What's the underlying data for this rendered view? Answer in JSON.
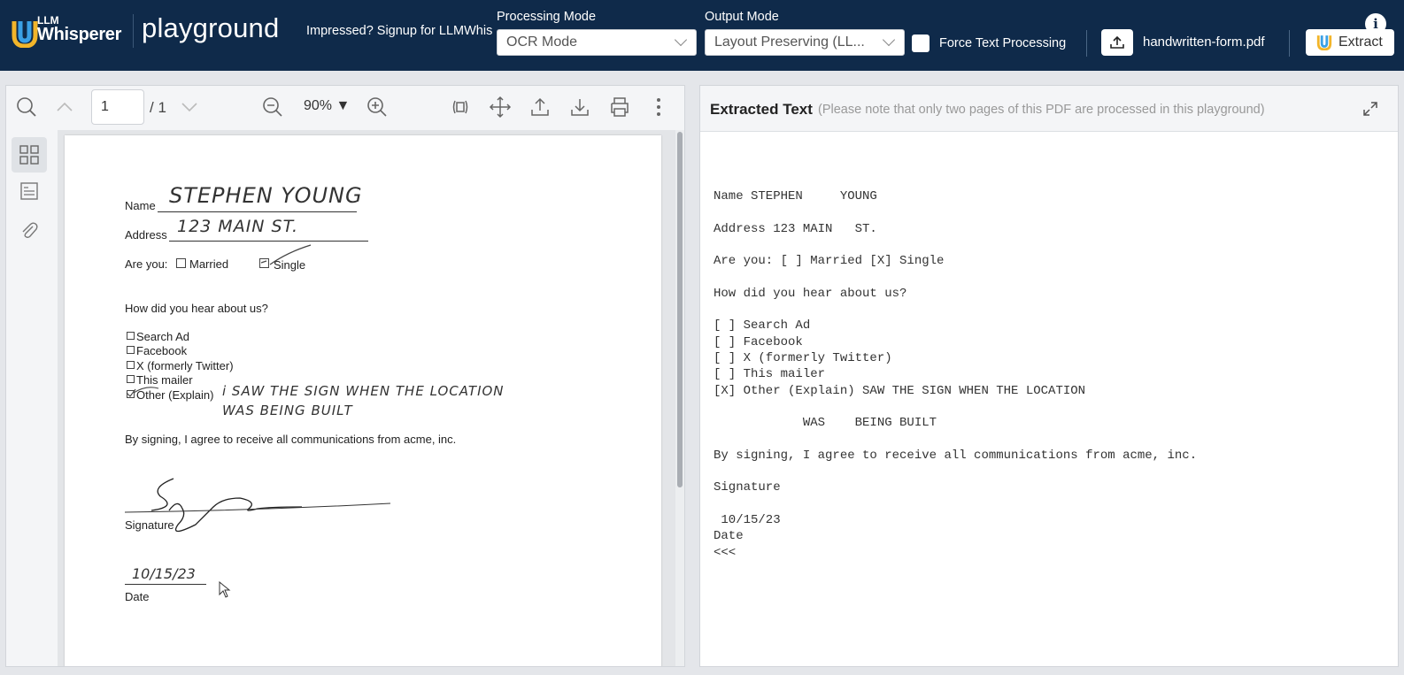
{
  "header": {
    "logo_top": "LLM",
    "logo_bottom": "Whisperer",
    "app_name": "playground",
    "promo": "Impressed? Signup for LLMWhisperer",
    "processing_mode_label": "Processing Mode",
    "processing_mode_value": "OCR Mode",
    "output_mode_label": "Output Mode",
    "output_mode_value": "Layout Preserving (LL...",
    "force_text_label": "Force Text Processing",
    "filename": "handwritten-form.pdf",
    "extract_label": "Extract",
    "info_glyph": "i",
    "brand_colors": {
      "navy": "#0f2a4a",
      "logo_blue": "#3aa0e6",
      "logo_yellow": "#f2b52a"
    }
  },
  "viewer": {
    "page_current": "1",
    "page_total": "/ 1",
    "zoom": "90% ▼",
    "icons": [
      "search-icon",
      "page-up-icon",
      "page-down-icon",
      "zoom-out-icon",
      "zoom-in-icon",
      "rotate-icon",
      "pan-icon",
      "upload-icon",
      "download-icon",
      "print-icon",
      "more-icon"
    ],
    "rail_icons": [
      "thumbnails-icon",
      "outline-icon",
      "attachment-icon"
    ]
  },
  "form": {
    "name_label": "Name",
    "name_value": "STEPHEN YOUNG",
    "address_label": "Address",
    "address_value": "123 MAIN ST.",
    "are_you_label": "Are you:",
    "married_label": "Married",
    "single_label": "Single",
    "question": "How did you hear about us?",
    "options": [
      "Search Ad",
      "Facebook",
      "X (formerly Twitter)",
      "This mailer",
      "Other (Explain)"
    ],
    "other_line1": "i SAW THE SIGN WHEN THE LOCATION",
    "other_line2": "WAS BEING BUILT",
    "consent": "By signing, I agree to receive all communications from acme, inc.",
    "signature_label": "Signature",
    "date_value": "10/15/23",
    "date_label": "Date"
  },
  "output": {
    "title": "Extracted Text",
    "note": "(Please note that only two pages of this PDF are processed in this playground)",
    "text": "Name STEPHEN     YOUNG\n\nAddress 123 MAIN   ST.\n\nAre you: [ ] Married [X] Single\n\nHow did you hear about us?\n\n[ ] Search Ad\n[ ] Facebook\n[ ] X (formerly Twitter)\n[ ] This mailer\n[X] Other (Explain) SAW THE SIGN WHEN THE LOCATION\n\n            WAS    BEING BUILT\n\nBy signing, I agree to receive all communications from acme, inc.\n\nSignature\n\n 10/15/23\nDate\n<<<"
  }
}
